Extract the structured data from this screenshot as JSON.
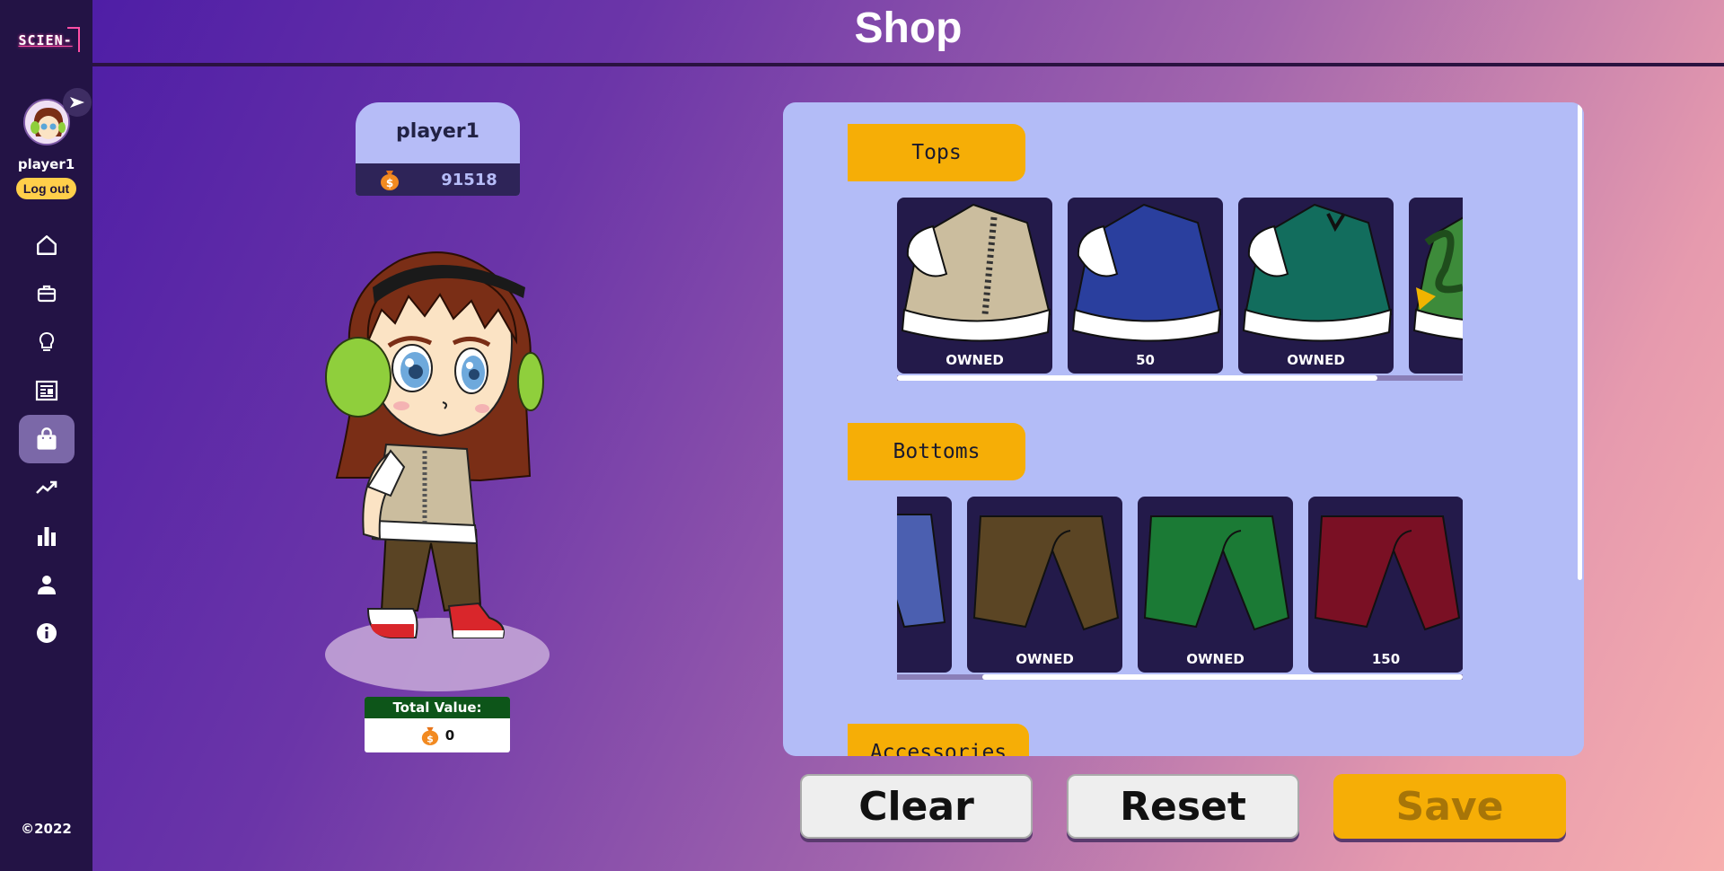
{
  "app": {
    "logo_text": "SCIEN-",
    "title": "Shop"
  },
  "sidebar": {
    "username": "player1",
    "logout_label": "Log out",
    "copyright": "©2022",
    "nav": [
      {
        "icon": "home-icon"
      },
      {
        "icon": "briefcase-icon"
      },
      {
        "icon": "lightbulb-icon"
      },
      {
        "icon": "newspaper-icon"
      },
      {
        "icon": "shopping-bag-icon",
        "active": true
      },
      {
        "icon": "trending-up-icon"
      },
      {
        "icon": "bar-chart-icon"
      },
      {
        "icon": "user-icon"
      },
      {
        "icon": "info-icon"
      }
    ]
  },
  "player": {
    "name": "player1",
    "coins": "91518"
  },
  "total": {
    "label": "Total Value:",
    "value": "0"
  },
  "categories": [
    {
      "name": "Tops",
      "items": [
        {
          "label": "OWNED",
          "color": "#cbbd9e"
        },
        {
          "label": "50",
          "color": "#2a3f9e"
        },
        {
          "label": "OWNED",
          "color": "#126d5d"
        },
        {
          "label": "",
          "color": "#3d8b3a"
        }
      ]
    },
    {
      "name": "Bottoms",
      "items": [
        {
          "label": "",
          "color": "#4b5fb0"
        },
        {
          "label": "OWNED",
          "color": "#5b4524"
        },
        {
          "label": "OWNED",
          "color": "#1b7a35"
        },
        {
          "label": "150",
          "color": "#7a1024"
        }
      ]
    },
    {
      "name": "Accessories",
      "items": []
    }
  ],
  "buttons": {
    "clear": "Clear",
    "reset": "Reset",
    "save": "Save"
  },
  "colors": {
    "sidebar": "#231345",
    "panel": "#b3bcf7",
    "accent": "#f6ae06"
  }
}
